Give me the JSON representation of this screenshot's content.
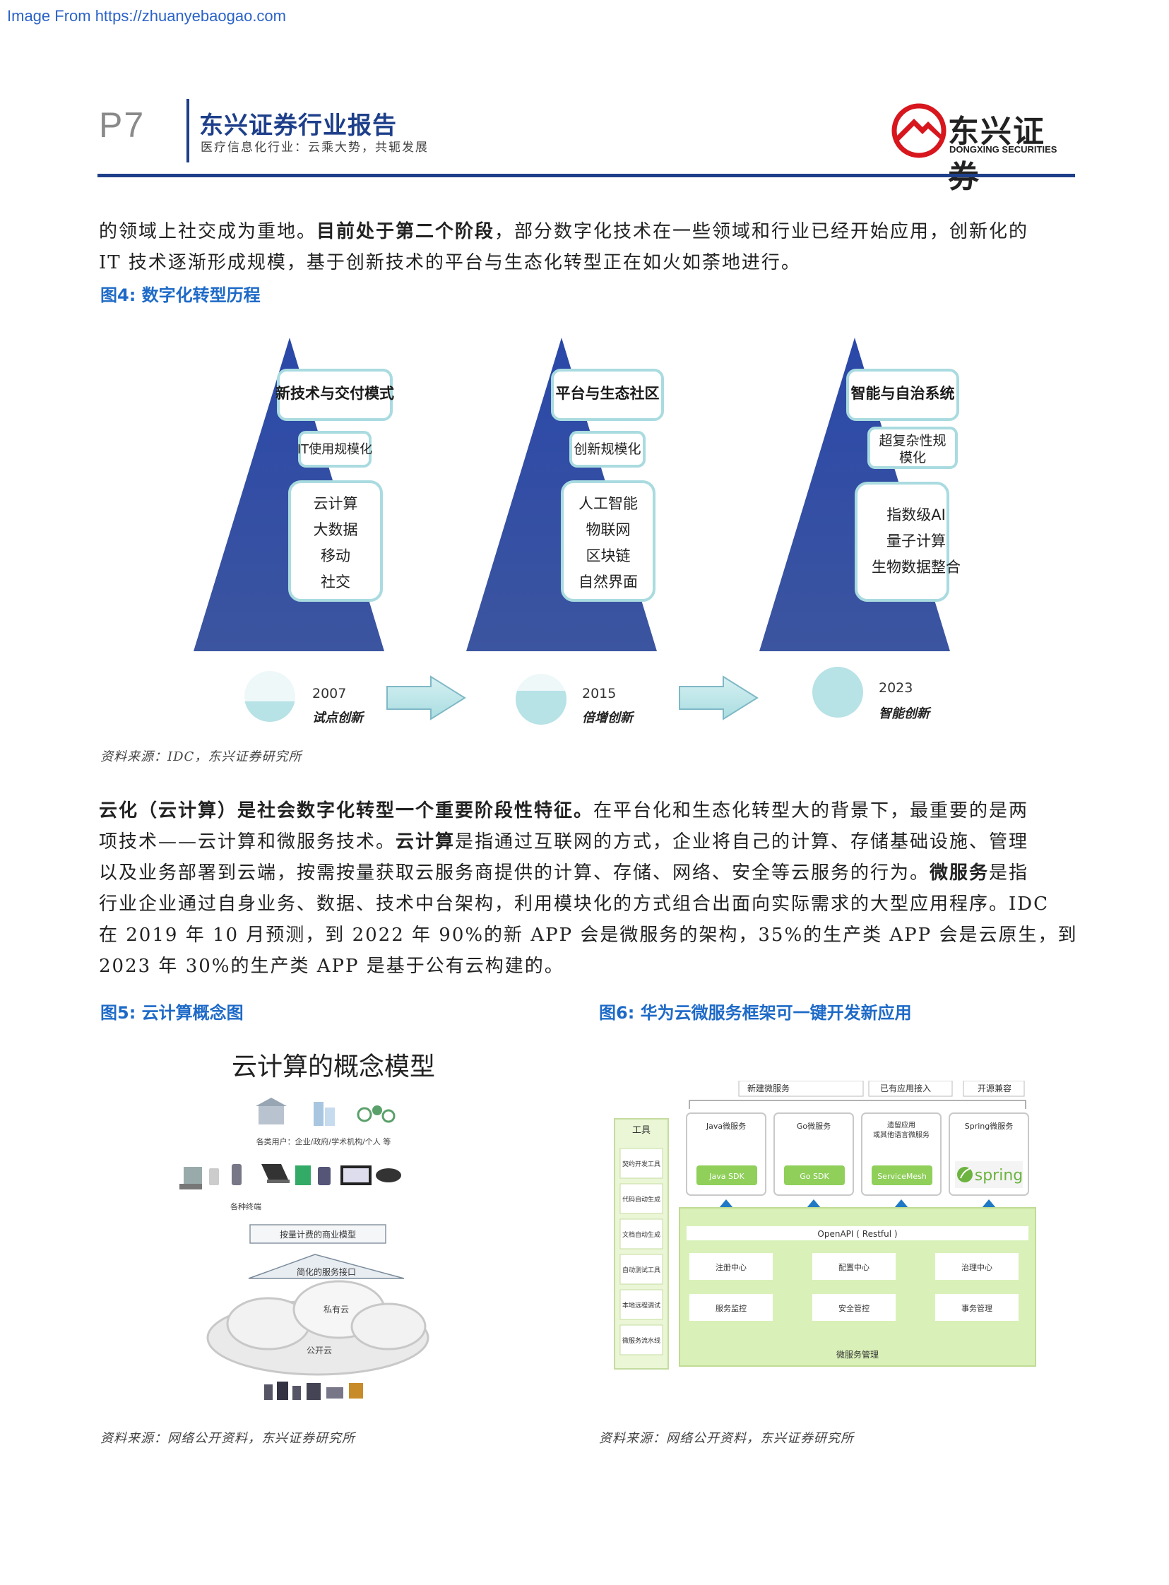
{
  "watermark": "Image From https://zhuanyebaogao.com",
  "header": {
    "page_number": "P7",
    "title": "东兴证券行业报告",
    "subtitle": "医疗信息化行业：云乘大势，共轭发展",
    "logo_cn": "东兴证券",
    "logo_en": "DONGXING SECURITIES"
  },
  "para1": {
    "a": "的领域上社交成为重地。",
    "b": "目前处于第二个阶段",
    "c": "，部分数字化技术在一些领域和行业已经开始应用，创新化的",
    "line2": "IT 技术逐渐形成规模，基于创新技术的平台与生态化转型正在如火如荼地进行。"
  },
  "fig4": {
    "title": "图4: 数字化转型历程",
    "stages": [
      {
        "header": "新技术与交付模式",
        "scale_l1": "IT使用规模化",
        "scale_l2": "",
        "tech": [
          "云计算",
          "大数据",
          "移动",
          "社交"
        ],
        "year": "2007",
        "label": "试点创新",
        "fill": 0.35
      },
      {
        "header": "平台与生态社区",
        "scale_l1": "创新规模化",
        "scale_l2": "",
        "tech": [
          "人工智能",
          "物联网",
          "区块链",
          "自然界面"
        ],
        "year": "2015",
        "label": "倍增创新",
        "fill": 0.65
      },
      {
        "header": "智能与自治系统",
        "scale_l1": "超复杂性规",
        "scale_l2": "模化",
        "tech": [
          "指数级AI",
          "量子计算",
          "生物数据整合"
        ],
        "year": "2023",
        "label": "智能创新",
        "fill": 1.0
      }
    ],
    "source": "资料来源：IDC，东兴证券研究所"
  },
  "para2": {
    "b1": "云化（云计算）是社会数字化转型一个重要阶段性特征。",
    "t1": "在平台化和生态化转型大的背景下，最重要的是两",
    "t2": "项技术——云计算和微服务技术。",
    "b2": "云计算",
    "t3": "是指通过互联网的方式，企业将自己的计算、存储基础设施、管理",
    "t4": "以及业务部署到云端，按需按量获取云服务商提供的计算、存储、网络、安全等云服务的行为。",
    "b3": "微服务",
    "t5": "是指",
    "t6": "行业企业通过自身业务、数据、技术中台架构，利用模块化的方式组合出面向实际需求的大型应用程序。IDC",
    "t7": "在 2019 年 10 月预测，到 2022 年 90%的新 APP 会是微服务的架构，35%的生产类 APP 会是云原生，到",
    "t8": "2023 年 30%的生产类 APP 是基于公有云构建的。"
  },
  "fig5": {
    "title": "图5: 云计算概念图",
    "diagram_title": "云计算的概念模型",
    "users_label": "各类用户：企业/政府/学术机构/个人 等",
    "terminals_label": "各种终端",
    "business_model": "按量计费的商业模型",
    "service_interface": "简化的服务接口",
    "private_cloud": "私有云",
    "public_cloud": "公开云",
    "source": "资料来源：网络公开资料，东兴证券研究所"
  },
  "fig6": {
    "title": "图6: 华为云微服务框架可一键开发新应用",
    "top_labels": [
      "新建微服务",
      "已有应用接入",
      "开源兼容"
    ],
    "tools_header": "工具",
    "tools": [
      "契约开发工具",
      "代码自动生成",
      "文档自动生成",
      "自动测试工具",
      "本地远程调试",
      "微服务流水线"
    ],
    "services": [
      {
        "name": "Java微服务",
        "name2": "",
        "sdk": "Java SDK"
      },
      {
        "name": "Go微服务",
        "name2": "",
        "sdk": "Go SDK"
      },
      {
        "name": "遗留应用",
        "name2": "或其他语言微服务",
        "sdk": "ServiceMesh"
      },
      {
        "name": "Spring微服务",
        "name2": "",
        "sdk": "spring"
      }
    ],
    "openapi": "OpenAPI ( Restful )",
    "modules": [
      "注册中心",
      "配置中心",
      "治理中心",
      "服务监控",
      "安全管控",
      "事务管理"
    ],
    "footer": "微服务管理",
    "source": "资料来源：网络公开资料，东兴证券研究所"
  },
  "colors": {
    "brand_blue": "#1e3f8a",
    "figure_title": "#1e6ac7",
    "logo_red": "#d7161e"
  }
}
